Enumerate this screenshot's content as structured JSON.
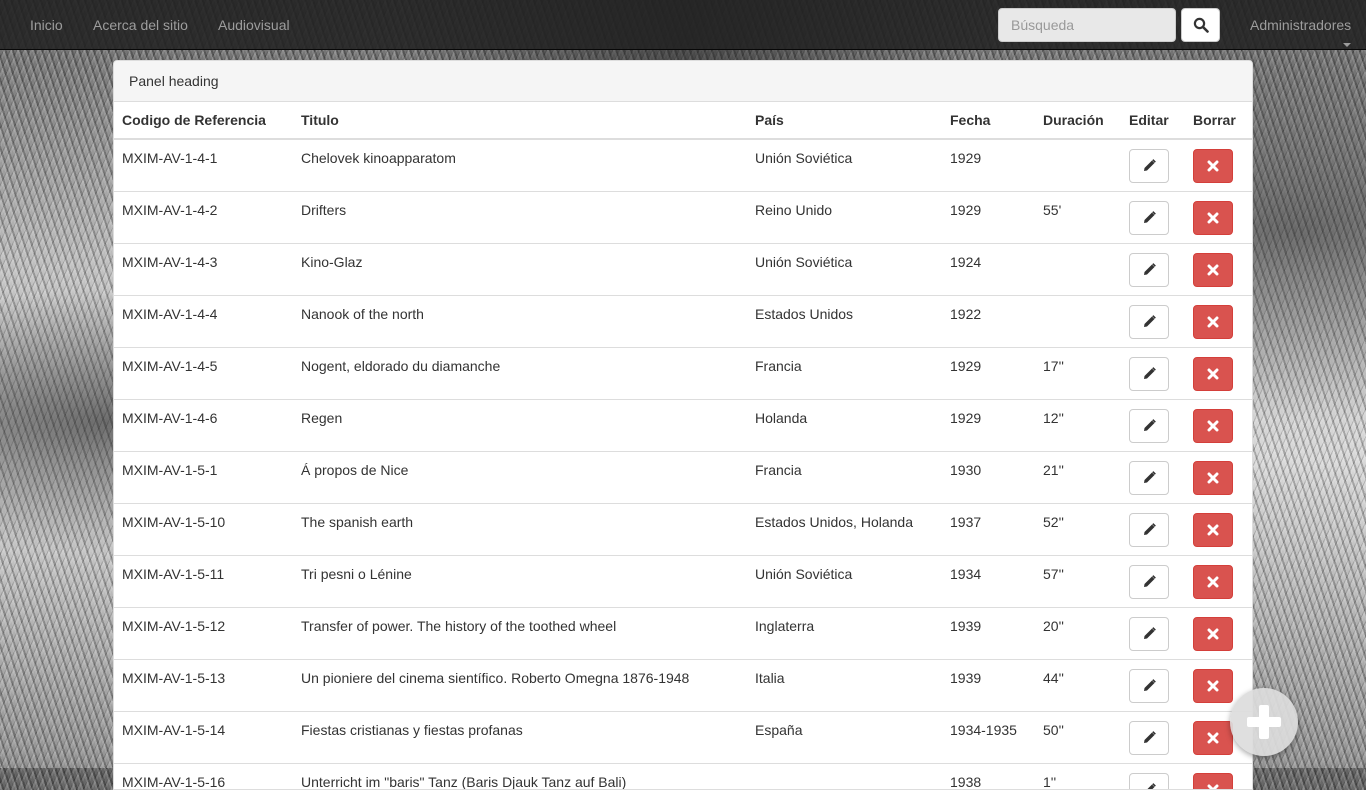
{
  "nav": {
    "links": [
      "Inicio",
      "Acerca del sitio",
      "Audiovisual"
    ],
    "search_placeholder": "Búsqueda",
    "admin_label": "Administradores"
  },
  "panel": {
    "heading": "Panel heading"
  },
  "table": {
    "columns": [
      "Codigo de Referencia",
      "Titulo",
      "País",
      "Fecha",
      "Duración",
      "Editar",
      "Borrar"
    ],
    "rows": [
      {
        "code": "MXIM-AV-1-4-1",
        "title": "Chelovek kinoapparatom",
        "country": "Unión Soviética",
        "date": "1929",
        "duration": ""
      },
      {
        "code": "MXIM-AV-1-4-2",
        "title": "Drifters",
        "country": "Reino Unido",
        "date": "1929",
        "duration": "55'"
      },
      {
        "code": "MXIM-AV-1-4-3",
        "title": "Kino-Glaz",
        "country": "Unión Soviética",
        "date": "1924",
        "duration": ""
      },
      {
        "code": "MXIM-AV-1-4-4",
        "title": "Nanook of the north",
        "country": "Estados Unidos",
        "date": "1922",
        "duration": ""
      },
      {
        "code": "MXIM-AV-1-4-5",
        "title": "Nogent, eldorado du diamanche",
        "country": "Francia",
        "date": "1929",
        "duration": "17''"
      },
      {
        "code": "MXIM-AV-1-4-6",
        "title": "Regen",
        "country": "Holanda",
        "date": "1929",
        "duration": "12''"
      },
      {
        "code": "MXIM-AV-1-5-1",
        "title": "Á propos de Nice",
        "country": "Francia",
        "date": "1930",
        "duration": "21''"
      },
      {
        "code": "MXIM-AV-1-5-10",
        "title": "The spanish earth",
        "country": "Estados Unidos, Holanda",
        "date": "1937",
        "duration": "52''"
      },
      {
        "code": "MXIM-AV-1-5-11",
        "title": "Tri pesni o Lénine",
        "country": "Unión Soviética",
        "date": "1934",
        "duration": "57''"
      },
      {
        "code": "MXIM-AV-1-5-12",
        "title": "Transfer of power. The history of the toothed wheel",
        "country": "Inglaterra",
        "date": "1939",
        "duration": "20''"
      },
      {
        "code": "MXIM-AV-1-5-13",
        "title": "Un pioniere del cinema sientífico. Roberto Omegna 1876-1948",
        "country": "Italia",
        "date": "1939",
        "duration": "44''"
      },
      {
        "code": "MXIM-AV-1-5-14",
        "title": "Fiestas cristianas y fiestas profanas",
        "country": "España",
        "date": "1934-1935",
        "duration": "50''"
      },
      {
        "code": "MXIM-AV-1-5-16",
        "title": "Unterricht im \"baris\" Tanz (Baris Djauk Tanz auf Bali)",
        "country": "",
        "date": "1938",
        "duration": "1''"
      }
    ]
  },
  "icons": {
    "search": "search-icon",
    "edit": "pencil-icon",
    "delete": "close-icon",
    "add": "plus-icon"
  },
  "colors": {
    "navbar": "#222222",
    "delete_button": "#d9534f",
    "nav_text": "#9d9d9d"
  }
}
